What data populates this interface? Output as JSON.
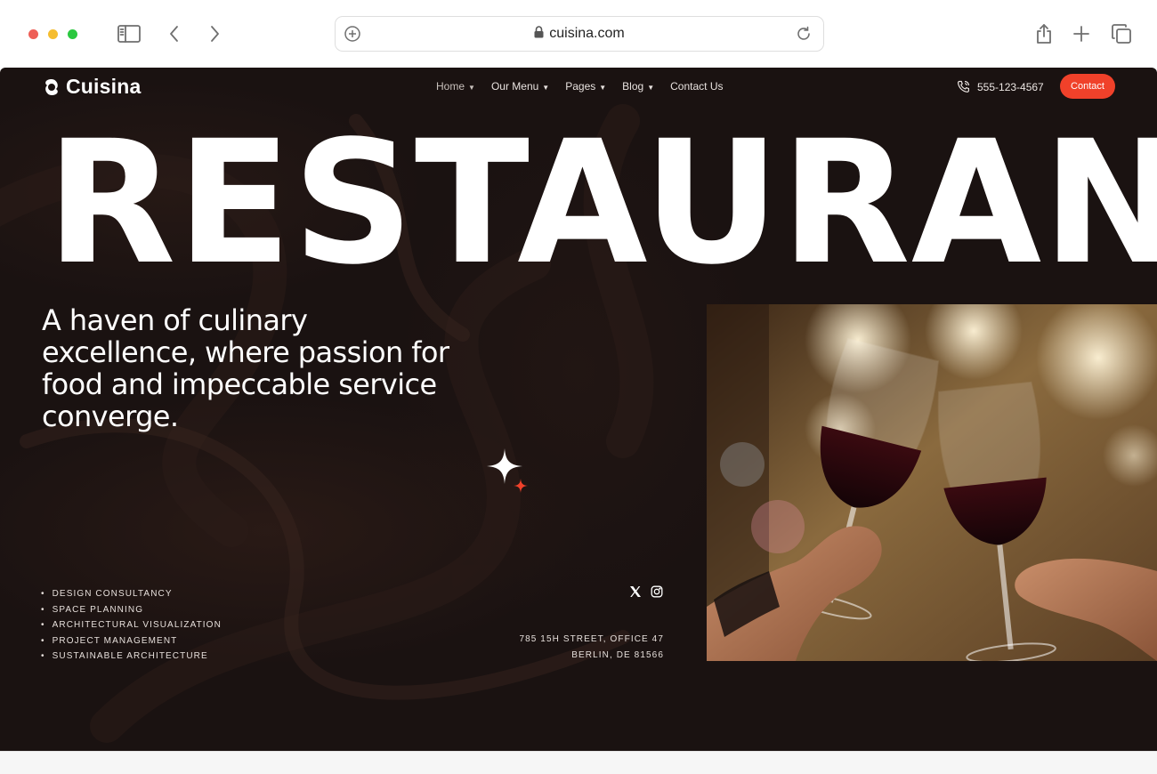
{
  "browser": {
    "url": "cuisina.com"
  },
  "site": {
    "logo_text": "Cuisina",
    "nav": [
      {
        "label": "Home",
        "dropdown": true
      },
      {
        "label": "Our Menu",
        "dropdown": true
      },
      {
        "label": "Pages",
        "dropdown": true
      },
      {
        "label": "Blog",
        "dropdown": true
      },
      {
        "label": "Contact Us",
        "dropdown": false
      }
    ],
    "phone": "555-123-4567",
    "contact_button": "Contact",
    "accent_color": "#f0412a",
    "hero_title": "RESTAURANT",
    "hero_subtitle": "A haven of culinary excellence, where passion for food and impeccable service converge.",
    "services": [
      "DESIGN CONSULTANCY",
      "SPACE PLANNING",
      "ARCHITECTURAL VISUALIZATION",
      "PROJECT MANAGEMENT",
      "SUSTAINABLE ARCHITECTURE"
    ],
    "social_icons": [
      "x-icon",
      "instagram-icon"
    ],
    "address_line1": "785 15H STREET, OFFICE 47",
    "address_line2": "BERLIN, DE 81566"
  }
}
